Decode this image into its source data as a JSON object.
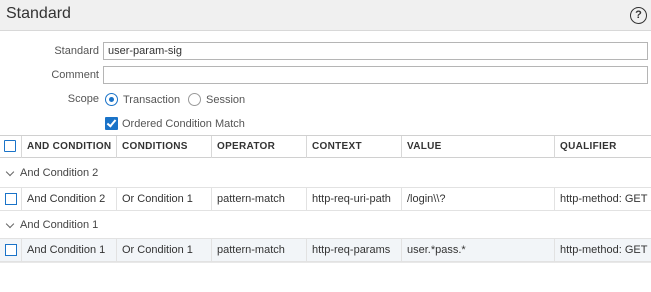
{
  "header": {
    "title": "Standard",
    "help_icon": "?"
  },
  "form": {
    "standard_label": "Standard",
    "standard_value": "user-param-sig",
    "comment_label": "Comment",
    "comment_value": "",
    "scope_label": "Scope",
    "scope_options": [
      "Transaction",
      "Session"
    ],
    "scope_selected": "Transaction",
    "ordered_match_label": "Ordered Condition Match",
    "ordered_match_checked": true
  },
  "table": {
    "columns": [
      "AND CONDITION",
      "CONDITIONS",
      "OPERATOR",
      "CONTEXT",
      "VALUE",
      "QUALIFIER"
    ],
    "groups": [
      {
        "label": "And Condition 2",
        "rows": [
          [
            "And Condition 2",
            "Or Condition 1",
            "pattern-match",
            "http-req-uri-path",
            "/login\\\\?",
            "http-method: GET"
          ]
        ]
      },
      {
        "label": "And Condition 1",
        "rows": [
          [
            "And Condition 1",
            "Or Condition 1",
            "pattern-match",
            "http-req-params",
            "user.*pass.*",
            "http-method: GET"
          ]
        ]
      }
    ]
  },
  "colors": {
    "accent": "#1a73c8",
    "header_bg": "#f0f0f0",
    "alt_row": "#f2f5f8"
  }
}
